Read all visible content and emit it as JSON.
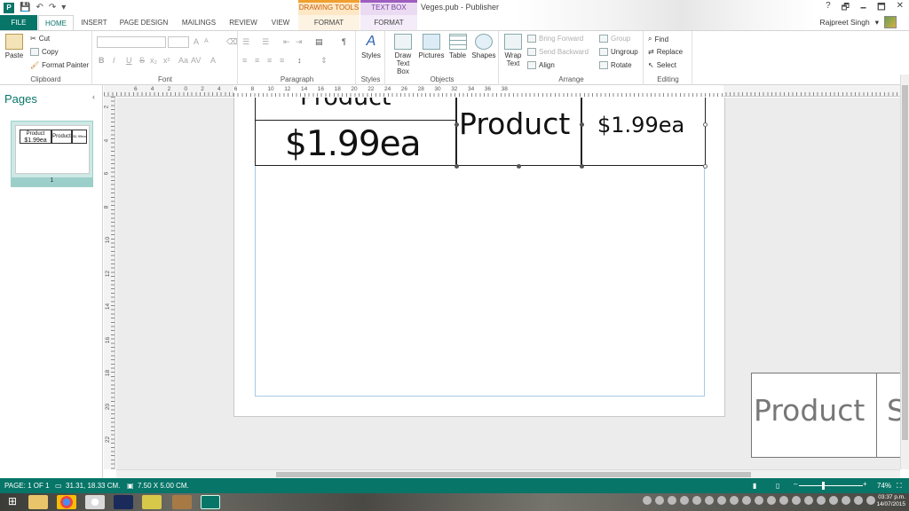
{
  "titlebar": {
    "doc_title": "Veges.pub - Publisher",
    "context_drawing": "DRAWING TOOLS",
    "context_textbox": "TEXT BOX TOOLS",
    "help": "?",
    "restore": "🗗",
    "minimize": "🗕",
    "maximize": "🗖",
    "close": "✕",
    "save_icon": "💾",
    "undo_icon": "↶",
    "redo_icon": "↷",
    "customize_icon": "▾"
  },
  "tabs": {
    "file": "FILE",
    "home": "HOME",
    "insert": "INSERT",
    "page_design": "PAGE DESIGN",
    "mailings": "MAILINGS",
    "review": "REVIEW",
    "view": "VIEW",
    "format_drawing": "FORMAT",
    "format_textbox": "FORMAT"
  },
  "user": {
    "name": "Rajpreet Singh",
    "dropdown": "▾"
  },
  "ribbon": {
    "clipboard": {
      "label": "Clipboard",
      "paste": "Paste",
      "cut": "Cut",
      "copy": "Copy",
      "format_painter": "Format Painter"
    },
    "font": {
      "label": "Font",
      "bold": "B",
      "italic": "I",
      "underline": "U",
      "strike": "S",
      "sub": "x₂",
      "sup": "x²",
      "size_up": "A",
      "size_down": "A"
    },
    "paragraph": {
      "label": "Paragraph",
      "pilcrow": "¶"
    },
    "styles": {
      "label": "Styles",
      "styles": "Styles"
    },
    "objects": {
      "label": "Objects",
      "draw_text_box_1": "Draw",
      "draw_text_box_2": "Text Box",
      "pictures": "Pictures",
      "table": "Table",
      "shapes": "Shapes"
    },
    "arrange": {
      "label": "Arrange",
      "wrap_text_1": "Wrap",
      "wrap_text_2": "Text",
      "bring_forward": "Bring Forward",
      "send_backward": "Send Backward",
      "align": "Align",
      "group": "Group",
      "ungroup": "Ungroup",
      "rotate": "Rotate"
    },
    "editing": {
      "label": "Editing",
      "find": "Find",
      "replace": "Replace",
      "select": "Select"
    }
  },
  "rulers": {
    "h_numbers": [
      "6",
      "4",
      "2",
      "0",
      "2",
      "4",
      "6",
      "8",
      "10",
      "12",
      "14",
      "16",
      "18",
      "20",
      "22",
      "24",
      "26",
      "28",
      "30",
      "32",
      "34",
      "36",
      "38"
    ],
    "v_numbers": [
      "2",
      "4",
      "6",
      "8",
      "10",
      "12",
      "14",
      "16",
      "18",
      "20",
      "22"
    ]
  },
  "pages_pane": {
    "title": "Pages",
    "collapse": "‹",
    "thumb_product": "Product",
    "thumb_price_big": "$1.99ea",
    "thumb_product2": "Product",
    "thumb_price_small": "$1.99ea",
    "page_number": "1"
  },
  "canvas": {
    "shape1_top": "Product",
    "shape1_price": "$1.99ea",
    "shape2": "Product",
    "shape3": "$1.99ea",
    "scratch_product": "Product",
    "scratch_cut": "S"
  },
  "status": {
    "page": "PAGE: 1 OF 1",
    "position": "31.31, 18.33 CM.",
    "size": "7.50 X  5.00 CM.",
    "zoom_out": "–",
    "zoom_in": "+",
    "zoom": "74%"
  },
  "taskbar": {
    "time": "03:37 p.m.",
    "date": "14/07/2015"
  }
}
